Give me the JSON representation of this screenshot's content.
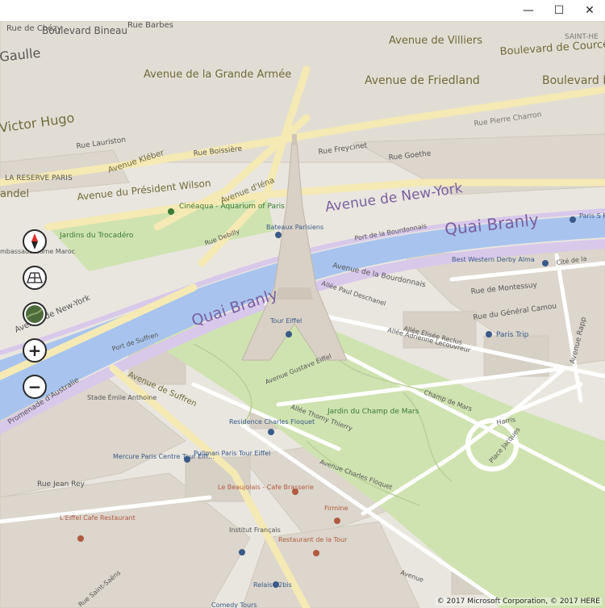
{
  "window": {
    "minimize_icon": "minimize-icon",
    "maximize_icon": "maximize-icon",
    "close_icon": "close-icon",
    "minimize_glyph": "—",
    "maximize_glyph": "☐",
    "close_glyph": "✕"
  },
  "map": {
    "colors": {
      "land": "#e9e6df",
      "water": "#a8c4ee",
      "park": "#cfe3b0",
      "road": "#ffffff",
      "major_road": "#f5e9b4",
      "quai": "#d8c8ea",
      "building": "#ddd8cf"
    },
    "labels": {
      "rue_de_chezy": "Rue de Chézy",
      "boulevard_bineau": "Boulevard Bineau",
      "rue_barbes": "Rue Barbes",
      "avenue_de_villiers": "Avenue de Villiers",
      "saint_he": "SAINT-HE",
      "boulevard_de_courcel": "Boulevard de Courcel",
      "gaulle": "Gaulle",
      "avenue_grande_armee": "Avenue de la Grande Armée",
      "avenue_de_friedland": "Avenue de Friedland",
      "boulevard_ha": "Boulevard Ha",
      "victor_hugo": "Victor Hugo",
      "rue_pierre_charron": "Rue Pierre Charron",
      "rue_lauriston": "Rue Lauriston",
      "rue_boissiere": "Rue Boissière",
      "rue_freycinet": "Rue Freycinet",
      "rue_goethe": "Rue Goethe",
      "avenue_kleber": "Avenue Kléber",
      "reserve_paris": "LA RESERVE PARIS",
      "mandel": "andel",
      "avenue_president_wilson": "Avenue du Président Wilson",
      "avenue_iena": "Avenue d'Iéna",
      "avenue_new_york": "Avenue de New-York",
      "cineaqua": "Cinéaqua - Aquarium of Paris",
      "jardins_trocadero": "Jardins du Trocadéro",
      "rue_debilly": "Rue Debilly",
      "bateaux": "Bateaux Parisiens",
      "port_bourdonnais": "Port de la Bourdonnais",
      "quai_branly": "Quai Branly",
      "paris_shop": "Paris S Passage",
      "embassade": "mbassade aume Maroc",
      "best_western": "Best Western Derby Alma",
      "cite_rive": "Cité de la",
      "avenue_bourdonnais": "Avenue de la Bourdonnais",
      "rue_montessuy": "Rue de Montessuy",
      "avenue_new_york_2": "Avenue de New-York",
      "allee_deschanel": "Allée Paul Deschanel",
      "rue_general_camou": "Rue du Général Camou",
      "paris_trip": "Paris Trip",
      "avenue_rapp": "Avenue Rapp",
      "quai_branly_2": "Quai Branly",
      "tour_eiffel": "Tour Eiffel",
      "port_suffren": "Port de Suffren",
      "allee_reclus": "Allée Elisée Reclus",
      "allee_lecouvreur": "Allée Adrienne Lecouvreur",
      "promenade_australie": "Promenade d'Australie",
      "avenue_gustave_eiffel": "Avenue Gustave Eiffel",
      "stade_emile_anthoine": "Stade Émile Anthoine",
      "avenue_suffren": "Avenue de Suffren",
      "jardin_champ_mars": "Jardin du Champ de Mars",
      "champ_de_mars": "Champ de Mars",
      "allee_thomy_thierry": "Allée Thomy Thierry",
      "residence_floquet": "Residence Charles Floquet",
      "place_jacques": "Place Jacques",
      "harris": "Harris",
      "mercure": "Mercure Paris Centre Tour Eiff...",
      "pullman": "Pullman Paris Tour Eiffel",
      "avenue_charles_floquet": "Avenue Charles Floquet",
      "rue_jean_rey": "Rue Jean Rey",
      "beaujolais": "Le Beaujolais - Cafe Brasserie",
      "eiffel_cafe": "L'Eiffel Cafe Restaurant",
      "firmine": "Firmine",
      "institut_francais": "Institut Français",
      "restaurant_tour": "Restaurant de la Tour",
      "relais_12bis": "Relais 12bis",
      "comedy_tours": "Comedy Tours",
      "avenue_saint_saens": "Rue Saint-Saëns",
      "avenue_floquet_2": "Avenue"
    }
  },
  "controls": {
    "compass_icon": "compass-icon",
    "tilt_icon": "tilt-icon",
    "style_icon": "map-style-icon",
    "zoom_in_icon": "zoom-in-icon",
    "zoom_out_icon": "zoom-out-icon",
    "zoom_in_glyph": "+",
    "zoom_out_glyph": "−"
  },
  "copyright": "© 2017 Microsoft Corporation, © 2017 HERE"
}
